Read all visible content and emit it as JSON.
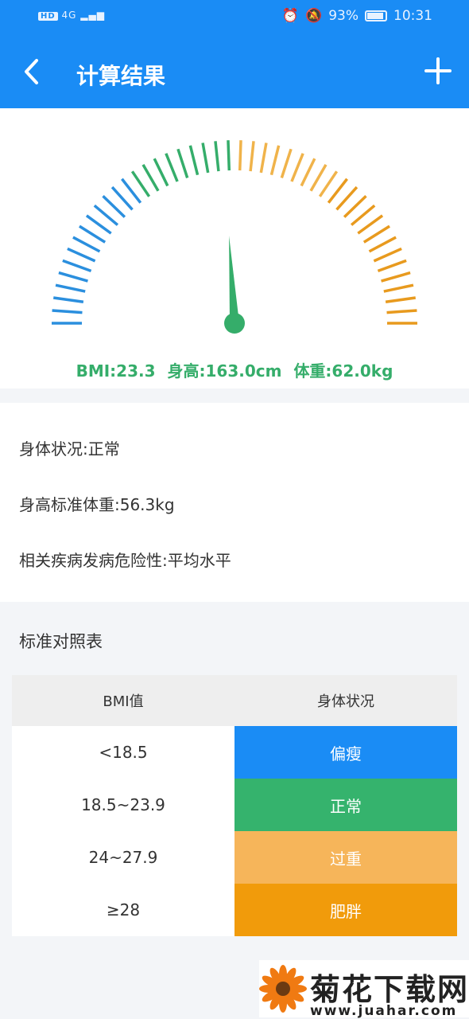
{
  "status_bar": {
    "network": "HD",
    "signal": "4G",
    "battery": "93%",
    "time": "10:31"
  },
  "header": {
    "title": "计算结果"
  },
  "gauge": {
    "bmi_text": "BMI:23.3",
    "height_text": "身高:163.0cm",
    "weight_text": "体重:62.0kg",
    "needle_fraction": 0.48,
    "colors": {
      "low": "#2b8fde",
      "normal": "#35ad6a",
      "over": "#f0b34a",
      "obese": "#e89a1e"
    }
  },
  "info": {
    "condition": "身体状况:正常",
    "standard_weight": "身高标准体重:56.3kg",
    "risk": "相关疾病发病危险性:平均水平"
  },
  "table": {
    "title": "标准对照表",
    "headers": [
      "BMI值",
      "身体状况"
    ],
    "rows": [
      {
        "value": "<18.5",
        "status": "偏瘦",
        "color": "#1a8cf5"
      },
      {
        "value": "18.5~23.9",
        "status": "正常",
        "color": "#35b36d"
      },
      {
        "value": "24~27.9",
        "status": "过重",
        "color": "#f6b55a"
      },
      {
        "value": "≥28",
        "status": "肥胖",
        "color": "#f19b0b"
      }
    ]
  },
  "watermark": {
    "text": "菊花下载网",
    "url": "www.juahar.com"
  }
}
